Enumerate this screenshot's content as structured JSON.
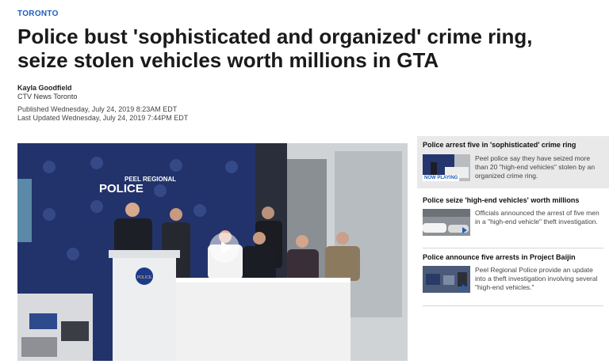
{
  "section": "TORONTO",
  "headline": "Police bust 'sophisticated and organized' crime ring, seize stolen vehicles worth millions in GTA",
  "author": "Kayla Goodfield",
  "outlet": "CTV News Toronto",
  "published": "Published Wednesday, July 24, 2019 8:23AM EDT",
  "updated": "Last Updated Wednesday, July 24, 2019 7:44PM EDT",
  "video": {
    "backdrop_line1": "PEEL REGIONAL",
    "backdrop_line2": "POLICE",
    "podium_text": "POLICE"
  },
  "playlist": [
    {
      "title": "Police arrest five in 'sophisticated' crime ring",
      "description": "Peel police say they have seized more than 20 \"high-end vehicles\" stolen by an organized crime ring.",
      "badge": "NOW PLAYING"
    },
    {
      "title": "Police seize 'high-end vehicles' worth millions",
      "description": "Officials announced the arrest of five men in a \"high-end vehicle\" theft investigation."
    },
    {
      "title": "Police announce five arrests in Project Baijin",
      "description": "Peel Regional Police provide an update into a theft investigation involving several \"high-end vehicles.\""
    }
  ]
}
